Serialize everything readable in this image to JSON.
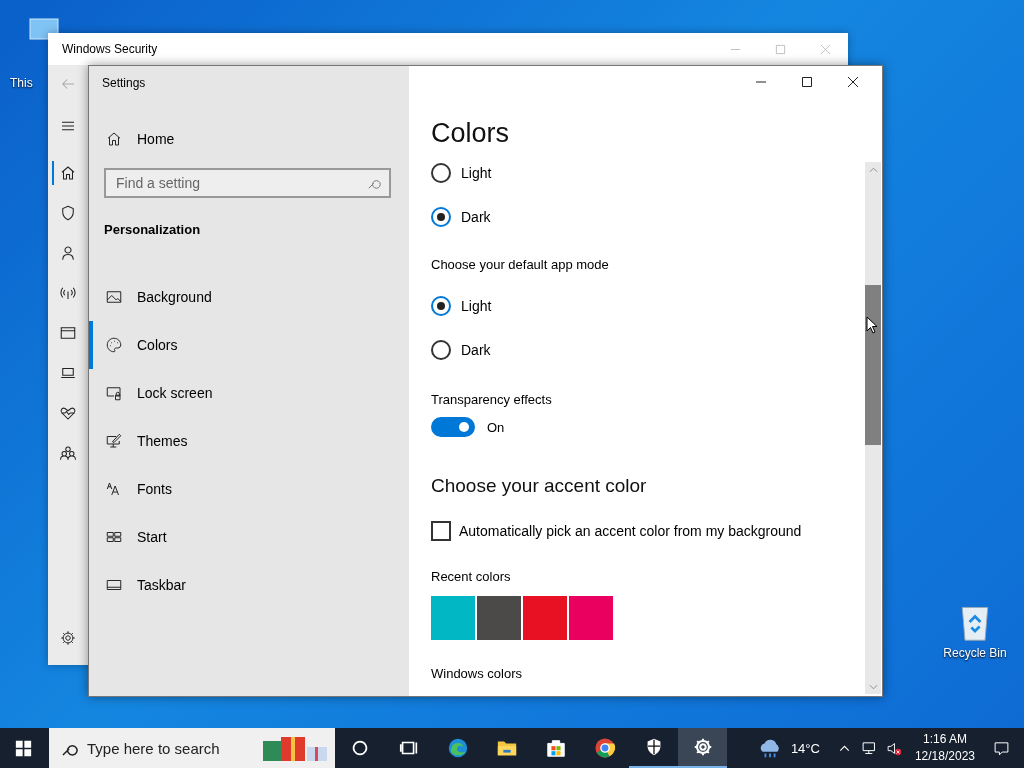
{
  "desktop_icons": [
    {
      "label": "This",
      "kind": "computer"
    },
    {
      "label": "Recycle Bin",
      "kind": "recycle"
    }
  ],
  "security_window": {
    "title": "Windows Security",
    "nav": [
      {
        "kind": "home",
        "selected": true
      },
      {
        "kind": "shield",
        "selected": false
      },
      {
        "kind": "person",
        "selected": false
      },
      {
        "kind": "wireless",
        "selected": false
      },
      {
        "kind": "browser",
        "selected": false
      },
      {
        "kind": "laptop",
        "selected": false
      },
      {
        "kind": "health",
        "selected": false
      },
      {
        "kind": "family",
        "selected": false
      }
    ]
  },
  "settings_window": {
    "title": "Settings",
    "home": "Home",
    "search": {
      "placeholder": "Find a setting"
    },
    "section": "Personalization",
    "nav": [
      {
        "label": "Background",
        "kind": "picture",
        "selected": false
      },
      {
        "label": "Colors",
        "kind": "palette",
        "selected": true
      },
      {
        "label": "Lock screen",
        "kind": "lock",
        "selected": false
      },
      {
        "label": "Themes",
        "kind": "themes",
        "selected": false
      },
      {
        "label": "Fonts",
        "kind": "fonts",
        "selected": false
      },
      {
        "label": "Start",
        "kind": "start",
        "selected": false
      },
      {
        "label": "Taskbar",
        "kind": "taskbar",
        "selected": false
      }
    ],
    "page": {
      "title": "Colors",
      "radio_groups": [
        {
          "options": [
            {
              "label": "Light",
              "selected": false
            },
            {
              "label": "Dark",
              "selected": true
            }
          ]
        },
        {
          "label": "Choose your default app mode",
          "options": [
            {
              "label": "Light",
              "selected": true
            },
            {
              "label": "Dark",
              "selected": false
            }
          ]
        }
      ],
      "transparency": {
        "label": "Transparency effects",
        "on": true,
        "state_text": "On"
      },
      "accent_heading": "Choose your accent color",
      "auto_pick": {
        "label": "Automatically pick an accent color from my background",
        "checked": false
      },
      "recent_colors": {
        "label": "Recent colors",
        "swatches": [
          {
            "color": "#00b7c3"
          },
          {
            "color": "#4c4a48"
          },
          {
            "color": "#e81123"
          },
          {
            "color": "#ea005e"
          }
        ]
      },
      "windows_colors_label": "Windows colors"
    }
  },
  "taskbar": {
    "search_placeholder": "Type here to search",
    "apps": [
      {
        "kind": "cortana",
        "active": false,
        "running": false
      },
      {
        "kind": "taskview",
        "active": false,
        "running": false
      },
      {
        "kind": "edge",
        "active": false,
        "running": false
      },
      {
        "kind": "folder",
        "active": false,
        "running": false
      },
      {
        "kind": "store",
        "active": false,
        "running": false
      },
      {
        "kind": "chrome",
        "active": false,
        "running": false
      },
      {
        "kind": "shield",
        "active": false,
        "running": true
      },
      {
        "kind": "gear",
        "active": true,
        "running": true
      }
    ],
    "temperature": "14°C",
    "time": "1:16 AM",
    "date": "12/18/2023"
  }
}
